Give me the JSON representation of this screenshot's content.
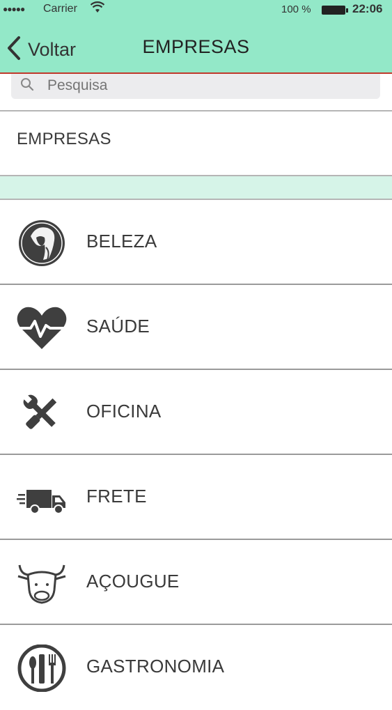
{
  "status_bar": {
    "signal": "●●●●●",
    "carrier": "Carrier",
    "wifi": "wifi-icon",
    "battery_percent": "100 %",
    "time": "22:06"
  },
  "nav": {
    "back_label": "Voltar",
    "title": "EMPRESAS",
    "bar_color": "#93e8c8",
    "accent_line_color": "#c0392b"
  },
  "search": {
    "placeholder": "Pesquisa"
  },
  "section": {
    "label": "EMPRESAS",
    "band_color": "#d6f4e8"
  },
  "categories": [
    {
      "label": "BELEZA",
      "icon": "beauty-portrait-icon"
    },
    {
      "label": "SAÚDE",
      "icon": "heart-pulse-icon"
    },
    {
      "label": "OFICINA",
      "icon": "wrench-screwdriver-icon"
    },
    {
      "label": "FRETE",
      "icon": "delivery-truck-icon"
    },
    {
      "label": "AÇOUGUE",
      "icon": "cow-head-icon"
    },
    {
      "label": "GASTRONOMIA",
      "icon": "cutlery-icon"
    }
  ]
}
